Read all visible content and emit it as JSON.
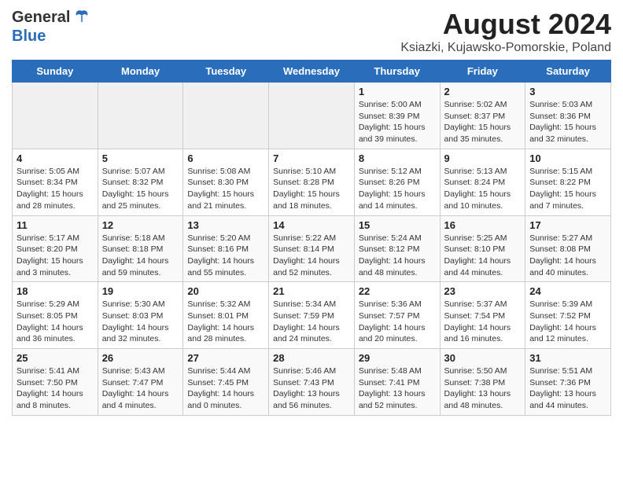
{
  "header": {
    "logo_general": "General",
    "logo_blue": "Blue",
    "title": "August 2024",
    "subtitle": "Ksiazki, Kujawsko-Pomorskie, Poland"
  },
  "days_of_week": [
    "Sunday",
    "Monday",
    "Tuesday",
    "Wednesday",
    "Thursday",
    "Friday",
    "Saturday"
  ],
  "weeks": [
    [
      {
        "day": "",
        "info": ""
      },
      {
        "day": "",
        "info": ""
      },
      {
        "day": "",
        "info": ""
      },
      {
        "day": "",
        "info": ""
      },
      {
        "day": "1",
        "info": "Sunrise: 5:00 AM\nSunset: 8:39 PM\nDaylight: 15 hours\nand 39 minutes."
      },
      {
        "day": "2",
        "info": "Sunrise: 5:02 AM\nSunset: 8:37 PM\nDaylight: 15 hours\nand 35 minutes."
      },
      {
        "day": "3",
        "info": "Sunrise: 5:03 AM\nSunset: 8:36 PM\nDaylight: 15 hours\nand 32 minutes."
      }
    ],
    [
      {
        "day": "4",
        "info": "Sunrise: 5:05 AM\nSunset: 8:34 PM\nDaylight: 15 hours\nand 28 minutes."
      },
      {
        "day": "5",
        "info": "Sunrise: 5:07 AM\nSunset: 8:32 PM\nDaylight: 15 hours\nand 25 minutes."
      },
      {
        "day": "6",
        "info": "Sunrise: 5:08 AM\nSunset: 8:30 PM\nDaylight: 15 hours\nand 21 minutes."
      },
      {
        "day": "7",
        "info": "Sunrise: 5:10 AM\nSunset: 8:28 PM\nDaylight: 15 hours\nand 18 minutes."
      },
      {
        "day": "8",
        "info": "Sunrise: 5:12 AM\nSunset: 8:26 PM\nDaylight: 15 hours\nand 14 minutes."
      },
      {
        "day": "9",
        "info": "Sunrise: 5:13 AM\nSunset: 8:24 PM\nDaylight: 15 hours\nand 10 minutes."
      },
      {
        "day": "10",
        "info": "Sunrise: 5:15 AM\nSunset: 8:22 PM\nDaylight: 15 hours\nand 7 minutes."
      }
    ],
    [
      {
        "day": "11",
        "info": "Sunrise: 5:17 AM\nSunset: 8:20 PM\nDaylight: 15 hours\nand 3 minutes."
      },
      {
        "day": "12",
        "info": "Sunrise: 5:18 AM\nSunset: 8:18 PM\nDaylight: 14 hours\nand 59 minutes."
      },
      {
        "day": "13",
        "info": "Sunrise: 5:20 AM\nSunset: 8:16 PM\nDaylight: 14 hours\nand 55 minutes."
      },
      {
        "day": "14",
        "info": "Sunrise: 5:22 AM\nSunset: 8:14 PM\nDaylight: 14 hours\nand 52 minutes."
      },
      {
        "day": "15",
        "info": "Sunrise: 5:24 AM\nSunset: 8:12 PM\nDaylight: 14 hours\nand 48 minutes."
      },
      {
        "day": "16",
        "info": "Sunrise: 5:25 AM\nSunset: 8:10 PM\nDaylight: 14 hours\nand 44 minutes."
      },
      {
        "day": "17",
        "info": "Sunrise: 5:27 AM\nSunset: 8:08 PM\nDaylight: 14 hours\nand 40 minutes."
      }
    ],
    [
      {
        "day": "18",
        "info": "Sunrise: 5:29 AM\nSunset: 8:05 PM\nDaylight: 14 hours\nand 36 minutes."
      },
      {
        "day": "19",
        "info": "Sunrise: 5:30 AM\nSunset: 8:03 PM\nDaylight: 14 hours\nand 32 minutes."
      },
      {
        "day": "20",
        "info": "Sunrise: 5:32 AM\nSunset: 8:01 PM\nDaylight: 14 hours\nand 28 minutes."
      },
      {
        "day": "21",
        "info": "Sunrise: 5:34 AM\nSunset: 7:59 PM\nDaylight: 14 hours\nand 24 minutes."
      },
      {
        "day": "22",
        "info": "Sunrise: 5:36 AM\nSunset: 7:57 PM\nDaylight: 14 hours\nand 20 minutes."
      },
      {
        "day": "23",
        "info": "Sunrise: 5:37 AM\nSunset: 7:54 PM\nDaylight: 14 hours\nand 16 minutes."
      },
      {
        "day": "24",
        "info": "Sunrise: 5:39 AM\nSunset: 7:52 PM\nDaylight: 14 hours\nand 12 minutes."
      }
    ],
    [
      {
        "day": "25",
        "info": "Sunrise: 5:41 AM\nSunset: 7:50 PM\nDaylight: 14 hours\nand 8 minutes."
      },
      {
        "day": "26",
        "info": "Sunrise: 5:43 AM\nSunset: 7:47 PM\nDaylight: 14 hours\nand 4 minutes."
      },
      {
        "day": "27",
        "info": "Sunrise: 5:44 AM\nSunset: 7:45 PM\nDaylight: 14 hours\nand 0 minutes."
      },
      {
        "day": "28",
        "info": "Sunrise: 5:46 AM\nSunset: 7:43 PM\nDaylight: 13 hours\nand 56 minutes."
      },
      {
        "day": "29",
        "info": "Sunrise: 5:48 AM\nSunset: 7:41 PM\nDaylight: 13 hours\nand 52 minutes."
      },
      {
        "day": "30",
        "info": "Sunrise: 5:50 AM\nSunset: 7:38 PM\nDaylight: 13 hours\nand 48 minutes."
      },
      {
        "day": "31",
        "info": "Sunrise: 5:51 AM\nSunset: 7:36 PM\nDaylight: 13 hours\nand 44 minutes."
      }
    ]
  ]
}
